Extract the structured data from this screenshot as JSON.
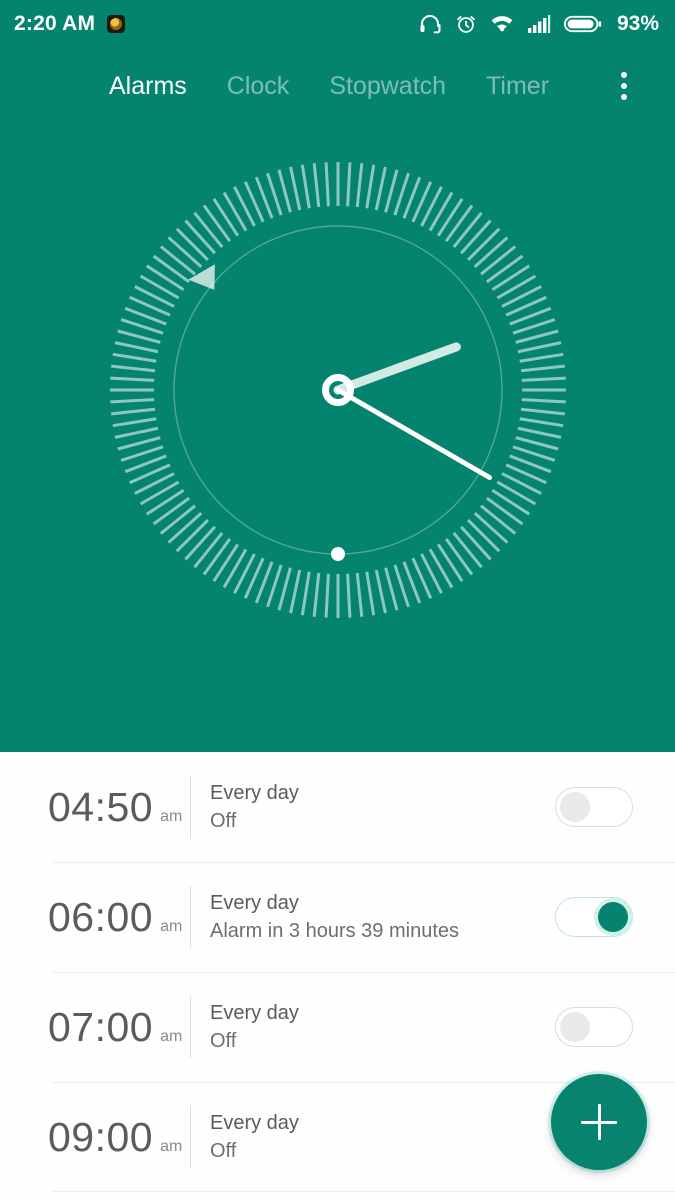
{
  "status_bar": {
    "time": "2:20 AM",
    "battery_percent": "93%",
    "icons": [
      "app-notification-icon",
      "headphones-icon",
      "alarm-clock-icon",
      "wifi-icon",
      "cellular-signal-icon",
      "battery-icon"
    ]
  },
  "tabs": [
    {
      "label": "Alarms",
      "active": true
    },
    {
      "label": "Clock",
      "active": false
    },
    {
      "label": "Stopwatch",
      "active": false
    },
    {
      "label": "Timer",
      "active": false
    }
  ],
  "overflow_menu": {
    "name": "more-options-icon"
  },
  "clock": {
    "hour_angle_deg": 70,
    "minute_angle_deg": 120,
    "alarm_marker_angle_deg": 310,
    "second_dot_angle_deg": 180,
    "displayed_time": "2:20",
    "tick_count": 120
  },
  "alarms": [
    {
      "time": "04:50",
      "meridiem": "am",
      "repeat": "Every day",
      "status": "Off",
      "enabled": false
    },
    {
      "time": "06:00",
      "meridiem": "am",
      "repeat": "Every day",
      "status": "Alarm in 3 hours 39 minutes",
      "enabled": true
    },
    {
      "time": "07:00",
      "meridiem": "am",
      "repeat": "Every day",
      "status": "Off",
      "enabled": false
    },
    {
      "time": "09:00",
      "meridiem": "am",
      "repeat": "Every day",
      "status": "Off",
      "enabled": false
    }
  ],
  "fab": {
    "name": "add-alarm-button",
    "glyph": "+"
  },
  "colors": {
    "accent_teal": "#04836f",
    "fab_teal": "#07836f",
    "list_background": "#fefefe",
    "primary_text": "#5b5b5b",
    "secondary_text": "#8a8a8a",
    "divider": "#ececec"
  }
}
